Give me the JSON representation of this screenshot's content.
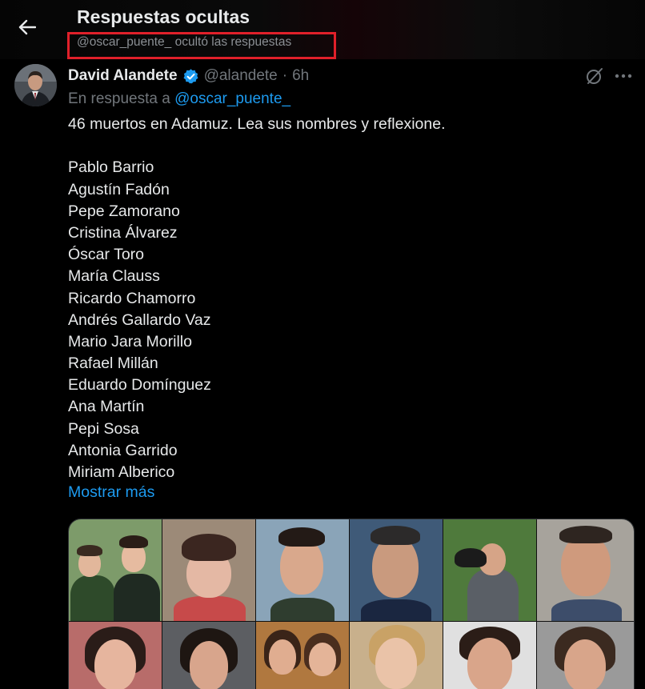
{
  "header": {
    "title": "Respuestas ocultas",
    "subtitle": "@oscar_puente_ ocultó las respuestas",
    "highlight_color": "#e0202a"
  },
  "tweet": {
    "author_name": "David Alandete",
    "verified": true,
    "handle": "@alandete",
    "separator": "·",
    "time": "6h",
    "reply_prefix": "En respuesta a",
    "reply_mention": "@oscar_puente_",
    "intro": "46 muertos en Adamuz. Lea sus nombres y reflexione.",
    "names": [
      "Pablo Barrio",
      "Agustín Fadón",
      "Pepe Zamorano",
      "Cristina Álvarez",
      "Óscar Toro",
      "María Clauss",
      "Ricardo Chamorro",
      "Andrés Gallardo Vaz",
      "Mario Jara Morillo",
      "Rafael Millán",
      "Eduardo Domínguez",
      "Ana Martín",
      "Pepi Sosa",
      "Antonia Garrido",
      "Miriam Alberico"
    ],
    "show_more": "Mostrar más"
  },
  "icons": {
    "back": "back-arrow-icon",
    "verified": "verified-badge-icon",
    "grok": "grok-icon",
    "more": "more-icon"
  },
  "colors": {
    "background": "#000000",
    "text": "#e7e9ea",
    "muted": "#71767b",
    "link": "#1d9bf0",
    "verified": "#1d9bf0"
  }
}
